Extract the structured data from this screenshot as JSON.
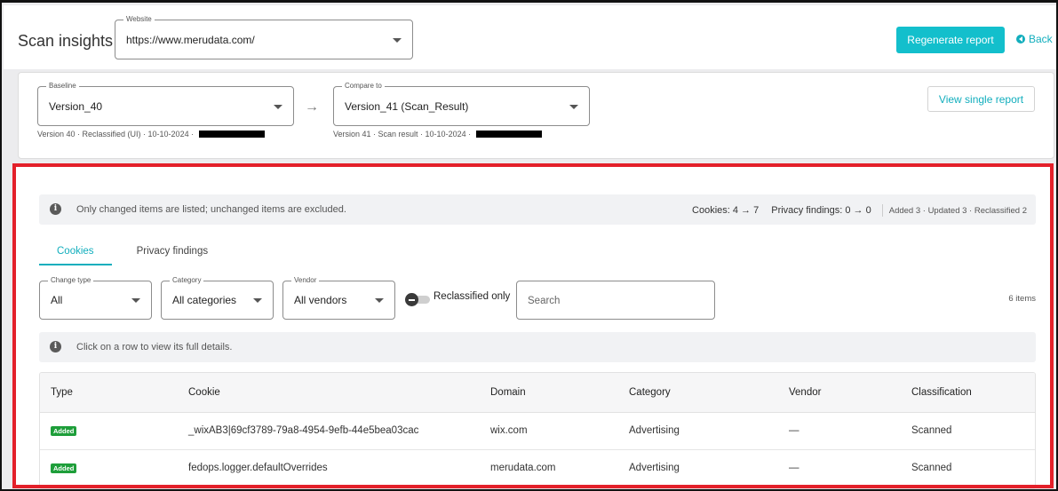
{
  "header": {
    "title": "Scan insights",
    "website": {
      "legend": "Website",
      "value": "https://www.merudata.com/"
    },
    "regenerate_label": "Regenerate report",
    "back_label": "Back"
  },
  "compare": {
    "baseline": {
      "legend": "Baseline",
      "value": "Version_40",
      "caption": "Version 40 · Reclassified (UI) · 10-10-2024 ·"
    },
    "compare_to": {
      "legend": "Compare to",
      "value": "Version_41 (Scan_Result)",
      "caption": "Version 41 · Scan result · 10-10-2024 ·"
    },
    "view_single_label": "View single report"
  },
  "info": {
    "text": "Only changed items are listed; unchanged items are excluded.",
    "cookies_stat": "Cookies: 4 → 7",
    "privacy_stat": "Privacy findings: 0 → 0",
    "summary": "Added 3 · Updated 3 · Reclassified 2"
  },
  "tabs": [
    {
      "label": "Cookies",
      "active": true
    },
    {
      "label": "Privacy findings",
      "active": false
    }
  ],
  "filters": {
    "change_type": {
      "legend": "Change type",
      "value": "All"
    },
    "category": {
      "legend": "Category",
      "value": "All categories"
    },
    "vendor": {
      "legend": "Vendor",
      "value": "All vendors"
    },
    "reclassified_only_label": "Reclassified only",
    "reclassified_only": false,
    "search_placeholder": "Search",
    "item_count": "6 items"
  },
  "hint": {
    "text": "Click on a row to view its full details."
  },
  "table": {
    "columns": [
      "Type",
      "Cookie",
      "Domain",
      "Category",
      "Vendor",
      "Classification"
    ],
    "rows": [
      {
        "type": "Added",
        "cookie": "_wixAB3|69cf3789-79a8-4954-9efb-44e5bea03cac",
        "domain": "wix.com",
        "category": "Advertising",
        "vendor": "—",
        "classification": "Scanned"
      },
      {
        "type": "Added",
        "cookie": "fedops.logger.defaultOverrides",
        "domain": "merudata.com",
        "category": "Advertising",
        "vendor": "—",
        "classification": "Scanned"
      }
    ]
  },
  "colors": {
    "accent": "#13bfcc",
    "badge_added": "#1e9e3a",
    "highlight_outline": "#e3202a"
  }
}
